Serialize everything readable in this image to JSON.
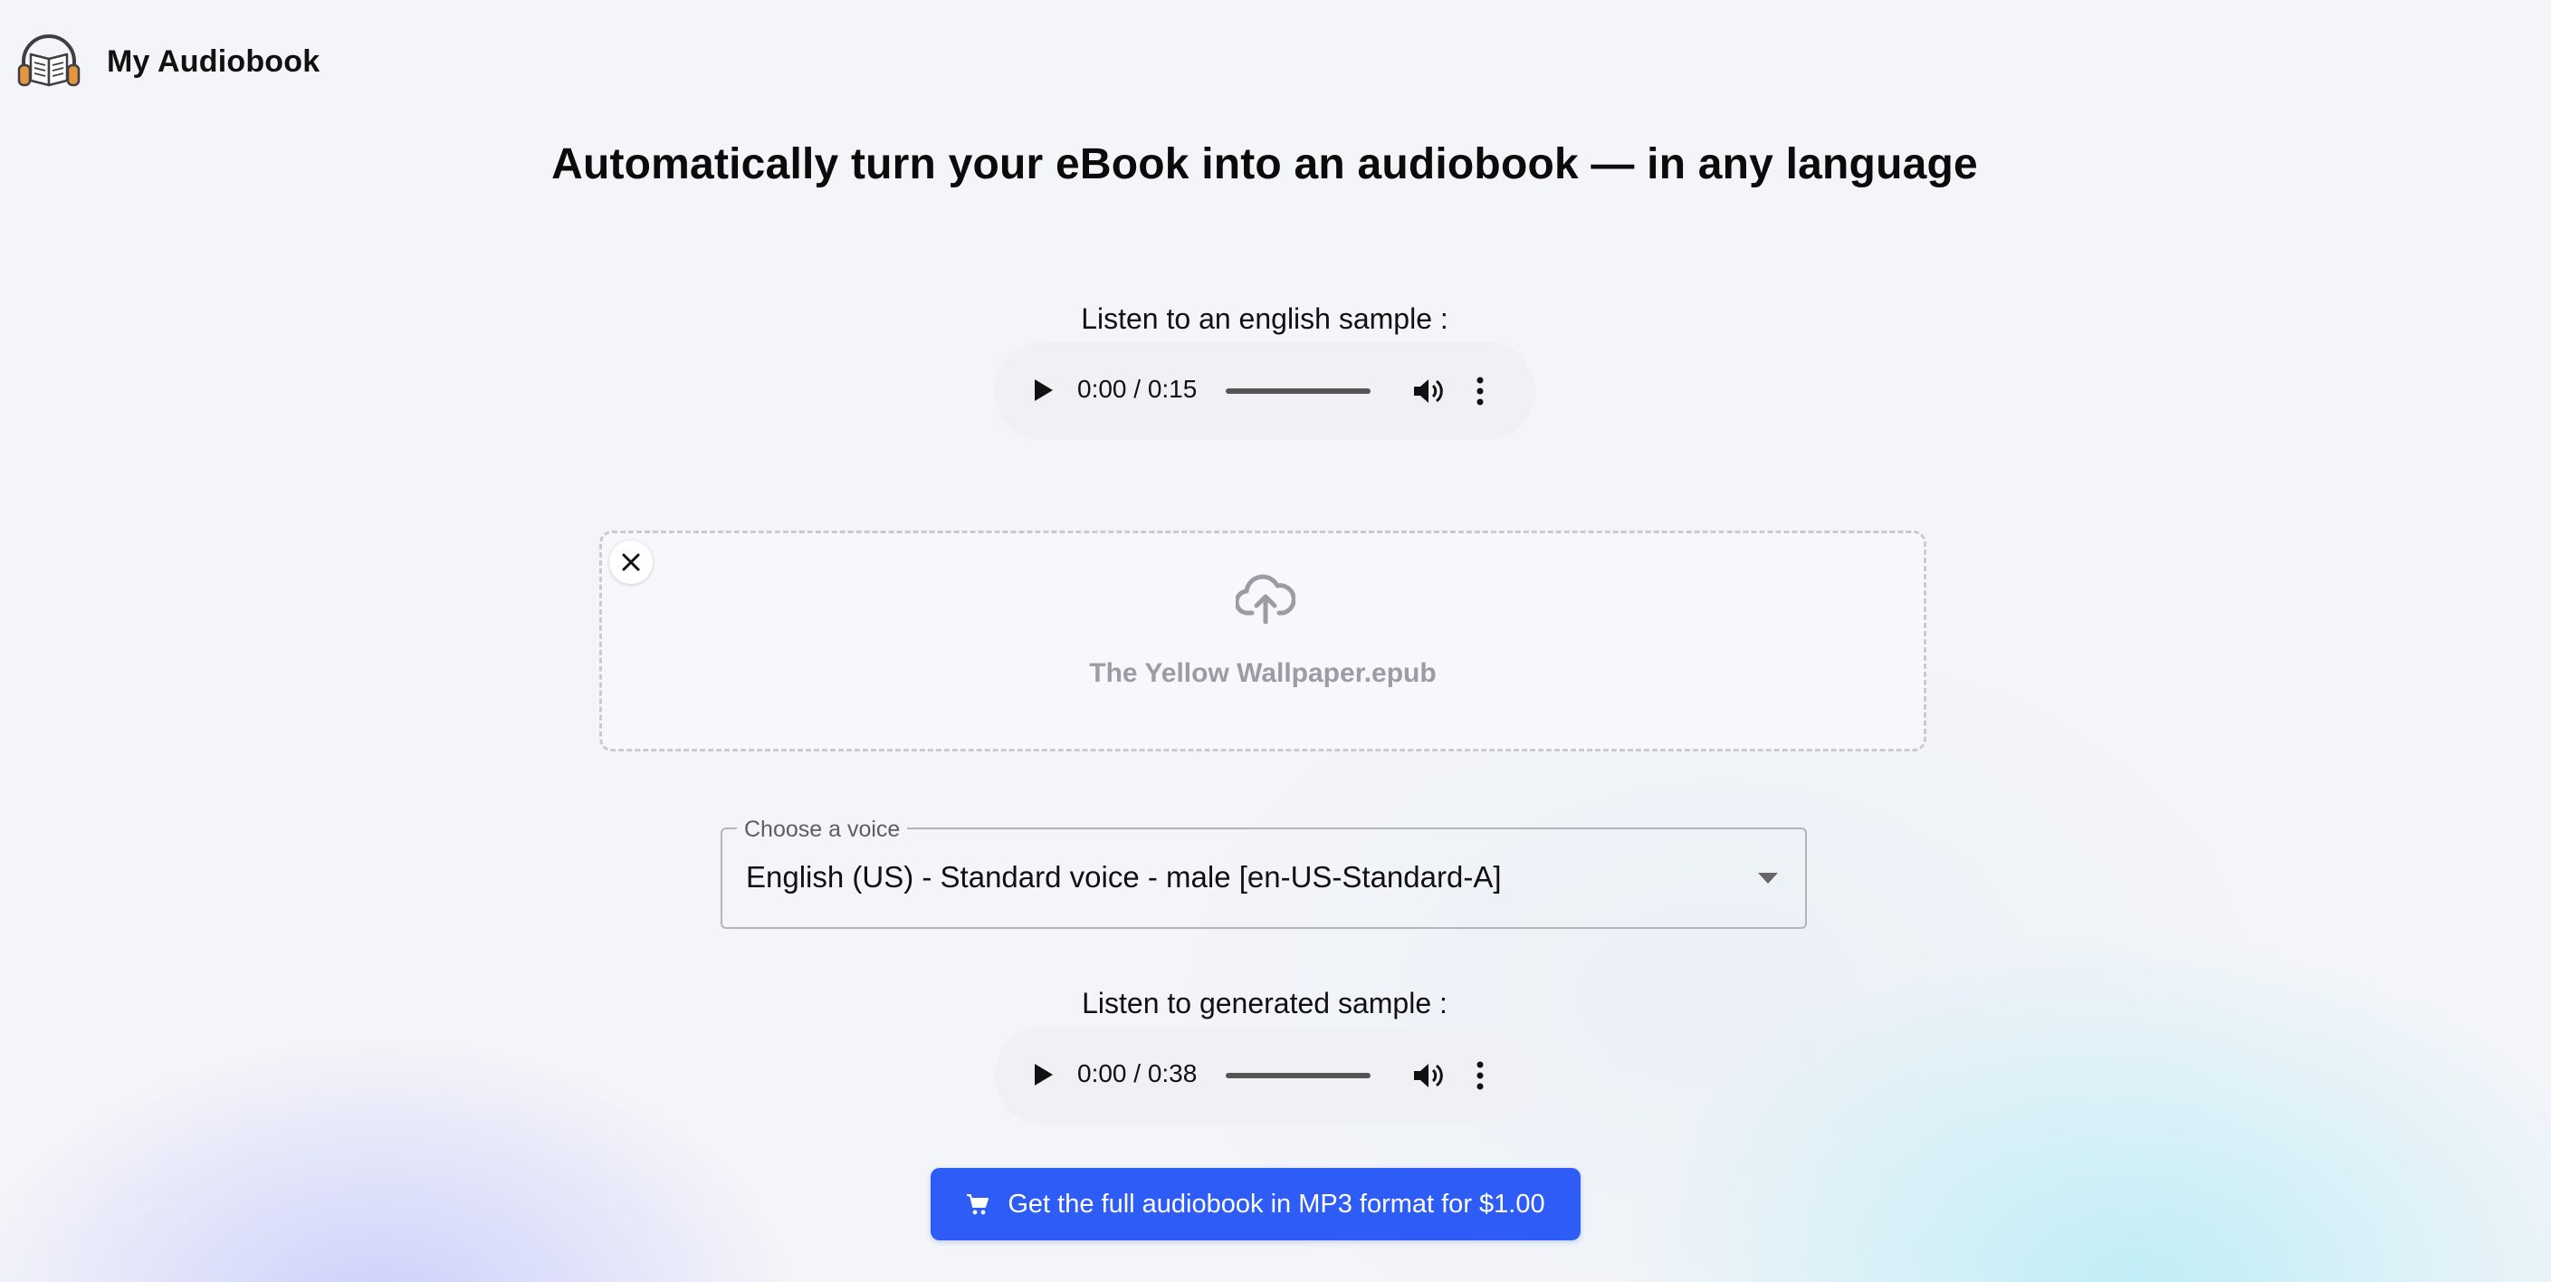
{
  "header": {
    "app_name": "My Audiobook",
    "logo_icon": "headphones-book-icon"
  },
  "headline": "Automatically turn your eBook into an audiobook — in any language",
  "english_sample": {
    "label": "Listen to an english sample :",
    "time": "0:00 / 0:15"
  },
  "upload": {
    "file_name": "The Yellow Wallpaper.epub",
    "icon": "cloud-upload-icon",
    "remove_icon": "close-icon"
  },
  "voice": {
    "label": "Choose a voice",
    "selected": "English (US) - Standard voice - male [en-US-Standard-A]"
  },
  "generated_sample": {
    "label": "Listen to generated sample :",
    "time": "0:00 / 0:38"
  },
  "buy_button": {
    "label": "Get the full audiobook in MP3 format for $1.00",
    "icon": "cart-icon"
  },
  "colors": {
    "accent": "#2d5cf6",
    "background": "#f4f5f9",
    "muted_text": "#9a9ca6"
  }
}
